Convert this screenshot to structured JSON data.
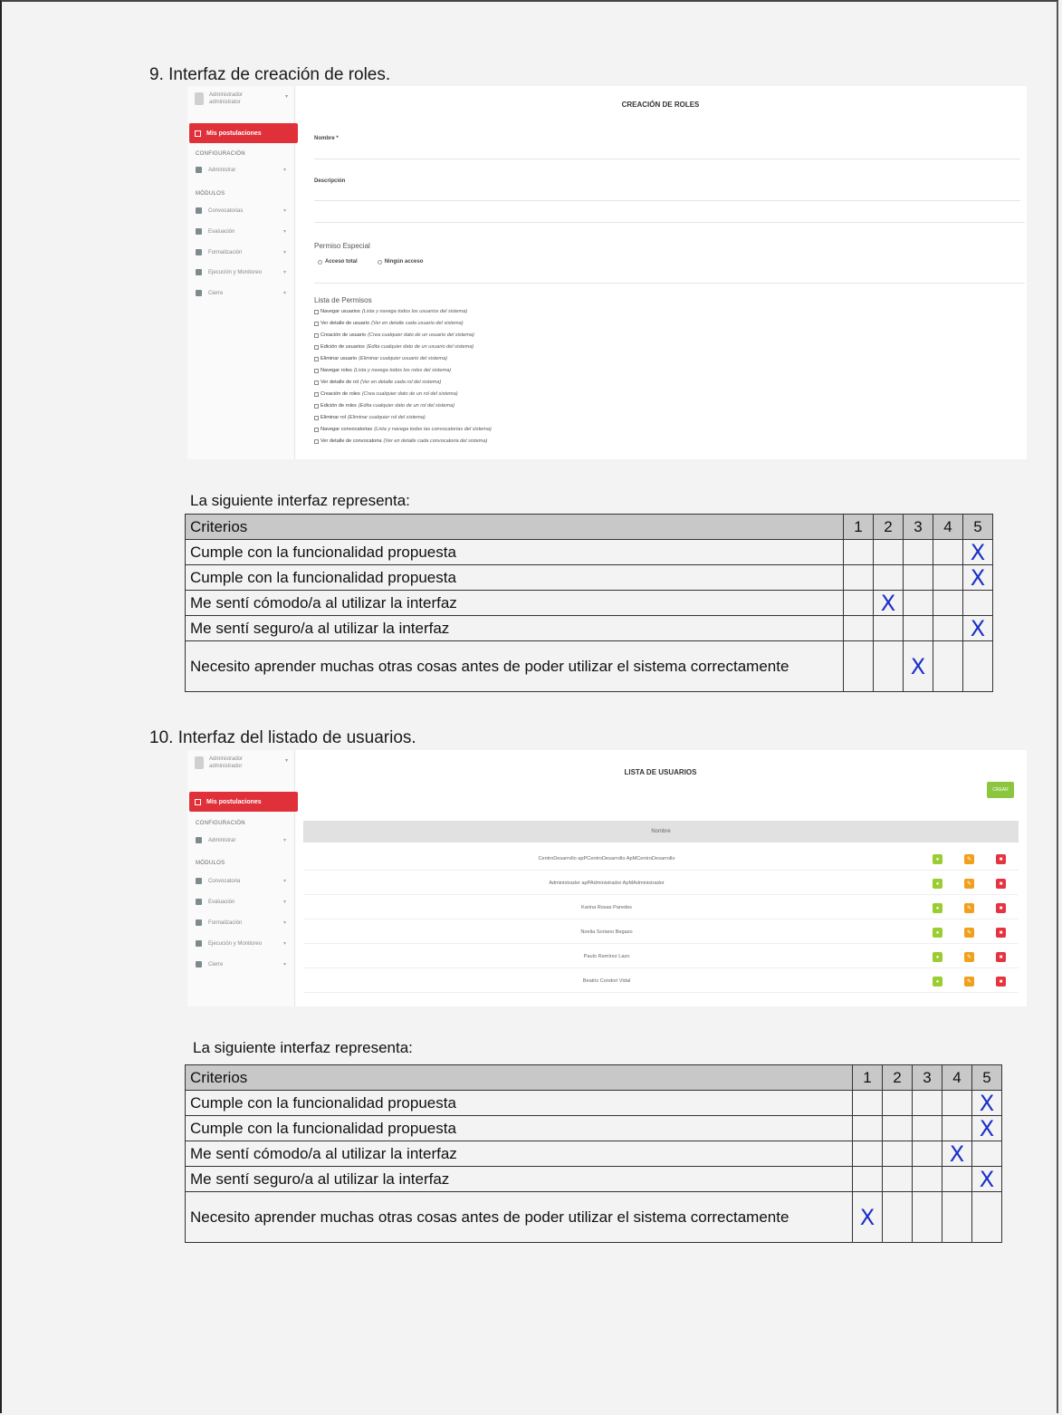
{
  "section9": {
    "title": "9.  Interfaz de creación de roles.",
    "screenshot": {
      "sidebar": {
        "user_name": "Administrador",
        "user_role": "administrator",
        "active_item": "Mis postulaciones",
        "config_heading": "CONFIGURACIÓN",
        "config_items": [
          {
            "label": "Administrar",
            "icon": "gears-icon"
          }
        ],
        "modules_heading": "MÓDULOS",
        "module_items": [
          {
            "label": "Convocatorias",
            "icon": "checklist-icon"
          },
          {
            "label": "Evaluación",
            "icon": "grid-icon"
          },
          {
            "label": "Formalización",
            "icon": "document-icon"
          },
          {
            "label": "Ejecución y Monitoreo",
            "icon": "pen-icon"
          },
          {
            "label": "Cierre",
            "icon": "box-icon"
          }
        ]
      },
      "title": "CREACIÓN DE ROLES",
      "name_label": "Nombre *",
      "description_label": "Descripción",
      "special_permission_label": "Permiso Especial",
      "radio_options": [
        "Acceso total",
        "Ningún acceso"
      ],
      "permissions_label": "Lista de Permisos",
      "permissions": [
        {
          "name": "Navegar usuarios",
          "desc": "(Lista y navega todos los usuarios del sistema)"
        },
        {
          "name": "Ver detalle de usuario",
          "desc": "(Ver en detalle cada usuario del sistema)"
        },
        {
          "name": "Creación de usuario",
          "desc": "(Crea cualquier dato de un usuario del sistema)"
        },
        {
          "name": "Edición de usuarios",
          "desc": "(Edita cualquier dato de un usuario del sistema)"
        },
        {
          "name": "Eliminar usuario",
          "desc": "(Eliminar cualquier usuario del sistema)"
        },
        {
          "name": "Navegar roles",
          "desc": "(Lista y navega todos los roles del sistema)"
        },
        {
          "name": "Ver detalle de rol",
          "desc": "(Ver en detalle cada rol del sistema)"
        },
        {
          "name": "Creación de roles",
          "desc": "(Crea cualquier dato de un rol del sistema)"
        },
        {
          "name": "Edición de roles",
          "desc": "(Edita cualquier dato de un rol del sistema)"
        },
        {
          "name": "Eliminar rol",
          "desc": "(Eliminar cualquier rol del sistema)"
        },
        {
          "name": "Navegar convocatorias",
          "desc": "(Lista y navega todas las convocatorias del sistema)"
        },
        {
          "name": "Ver detalle de convocatoria",
          "desc": "(Ver en detalle cada convocatoria del sistema)"
        }
      ]
    },
    "evaluation": {
      "intro": "La siguiente interfaz representa:",
      "header": "Criterios",
      "scale": [
        "1",
        "2",
        "3",
        "4",
        "5"
      ],
      "rows": [
        {
          "criterion": "Cumple con la funcionalidad propuesta",
          "selected": 5
        },
        {
          "criterion": "Cumple con la funcionalidad propuesta",
          "selected": 5
        },
        {
          "criterion": "Me sentí cómodo/a al utilizar la interfaz",
          "selected": 2
        },
        {
          "criterion": "Me sentí seguro/a al utilizar la interfaz",
          "selected": 5
        },
        {
          "criterion": "Necesito aprender muchas otras cosas antes de poder utilizar el sistema correctamente",
          "selected": 3
        }
      ]
    }
  },
  "section10": {
    "title": "10. Interfaz del listado de usuarios.",
    "screenshot": {
      "sidebar": {
        "user_name": "Administrador",
        "user_role": "administrador",
        "active_item": "Mis postulaciones",
        "config_heading": "CONFIGURACIÓN",
        "config_items": [
          {
            "label": "Administrar",
            "icon": "gears-icon"
          }
        ],
        "modules_heading": "MÓDULOS",
        "module_items": [
          {
            "label": "Convocatoria",
            "icon": "checklist-icon"
          },
          {
            "label": "Evaluación",
            "icon": "grid-icon"
          },
          {
            "label": "Formalización",
            "icon": "document-icon"
          },
          {
            "label": "Ejecución y Monitoreo",
            "icon": "pen-icon"
          },
          {
            "label": "Cierre",
            "icon": "box-icon"
          }
        ]
      },
      "title": "LISTA DE USUARIOS",
      "add_button": "CREAR",
      "column_header": "Nombre",
      "users": [
        "CentroDesarrollo apPCentroDesarrollo ApMCentroDesarrollo",
        "Administrador apPAdministrador ApMAdministrador",
        "Karina Rosas Paredes",
        "Noelia Soriano Begazo",
        "Paulo Ramírez Lazo",
        "Beatriz Condori Vidal"
      ],
      "row_actions": {
        "view_icon": "eye-icon",
        "edit_icon": "pencil-icon",
        "delete_icon": "trash-icon"
      }
    },
    "evaluation": {
      "intro": "La siguiente interfaz representa:",
      "header": "Criterios",
      "scale": [
        "1",
        "2",
        "3",
        "4",
        "5"
      ],
      "rows": [
        {
          "criterion": "Cumple con la funcionalidad propuesta",
          "selected": 5
        },
        {
          "criterion": "Cumple con la funcionalidad propuesta",
          "selected": 5
        },
        {
          "criterion": "Me sentí cómodo/a al utilizar la interfaz",
          "selected": 4
        },
        {
          "criterion": "Me sentí seguro/a al utilizar la interfaz",
          "selected": 5
        },
        {
          "criterion": "Necesito aprender muchas otras cosas antes de poder utilizar el sistema correctamente",
          "selected": 1
        }
      ]
    }
  },
  "mark_symbol": "X",
  "colors": {
    "mark": "#1a2fc8",
    "active_menu": "#e0303a",
    "btn_view": "#9acd32",
    "btn_edit": "#f0a01e",
    "btn_delete": "#e53340",
    "btn_add": "#8cc63f"
  }
}
